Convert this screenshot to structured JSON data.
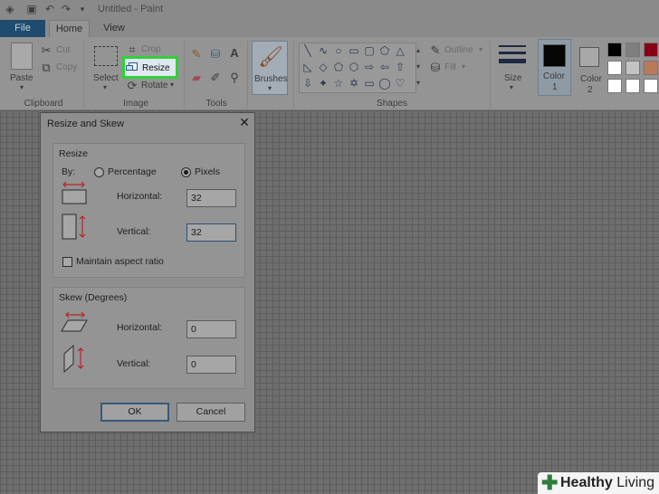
{
  "window": {
    "title": "Untitled - Paint"
  },
  "menu": {
    "file": "File",
    "home": "Home",
    "view": "View"
  },
  "ribbon": {
    "clipboard": {
      "label": "Clipboard",
      "paste": "Paste",
      "cut": "Cut",
      "copy": "Copy"
    },
    "image": {
      "label": "Image",
      "select": "Select",
      "crop": "Crop",
      "resize": "Resize",
      "rotate": "Rotate"
    },
    "tools": {
      "label": "Tools"
    },
    "brushes": "Brushes",
    "shapes": {
      "label": "Shapes",
      "outline": "Outline",
      "fill": "Fill"
    },
    "size": "Size",
    "color1": "Color\n1",
    "color1_line1": "Color",
    "color1_line2": "1",
    "color2_line1": "Color",
    "color2_line2": "2",
    "palette": [
      "#000000",
      "#7f7f7f",
      "#880015",
      "#ffffff",
      "#c3c3c3",
      "#b97a57",
      "#ffffff",
      "#ffffff",
      "#ffffff"
    ]
  },
  "dialog": {
    "title": "Resize and Skew",
    "close": "✕",
    "resize": {
      "label": "Resize",
      "by": "By:",
      "percentage": "Percentage",
      "pixels": "Pixels",
      "horizontal_label": "Horizontal:",
      "horizontal_value": "32",
      "vertical_label": "Vertical:",
      "vertical_value": "32",
      "maintain_aspect": "Maintain aspect ratio"
    },
    "skew": {
      "label": "Skew (Degrees)",
      "horizontal_label": "Horizontal:",
      "horizontal_value": "0",
      "vertical_label": "Vertical:",
      "vertical_value": "0"
    },
    "ok": "OK",
    "cancel": "Cancel"
  },
  "watermark": {
    "brand_bold": "Healthy",
    "brand_rest": " Living"
  }
}
